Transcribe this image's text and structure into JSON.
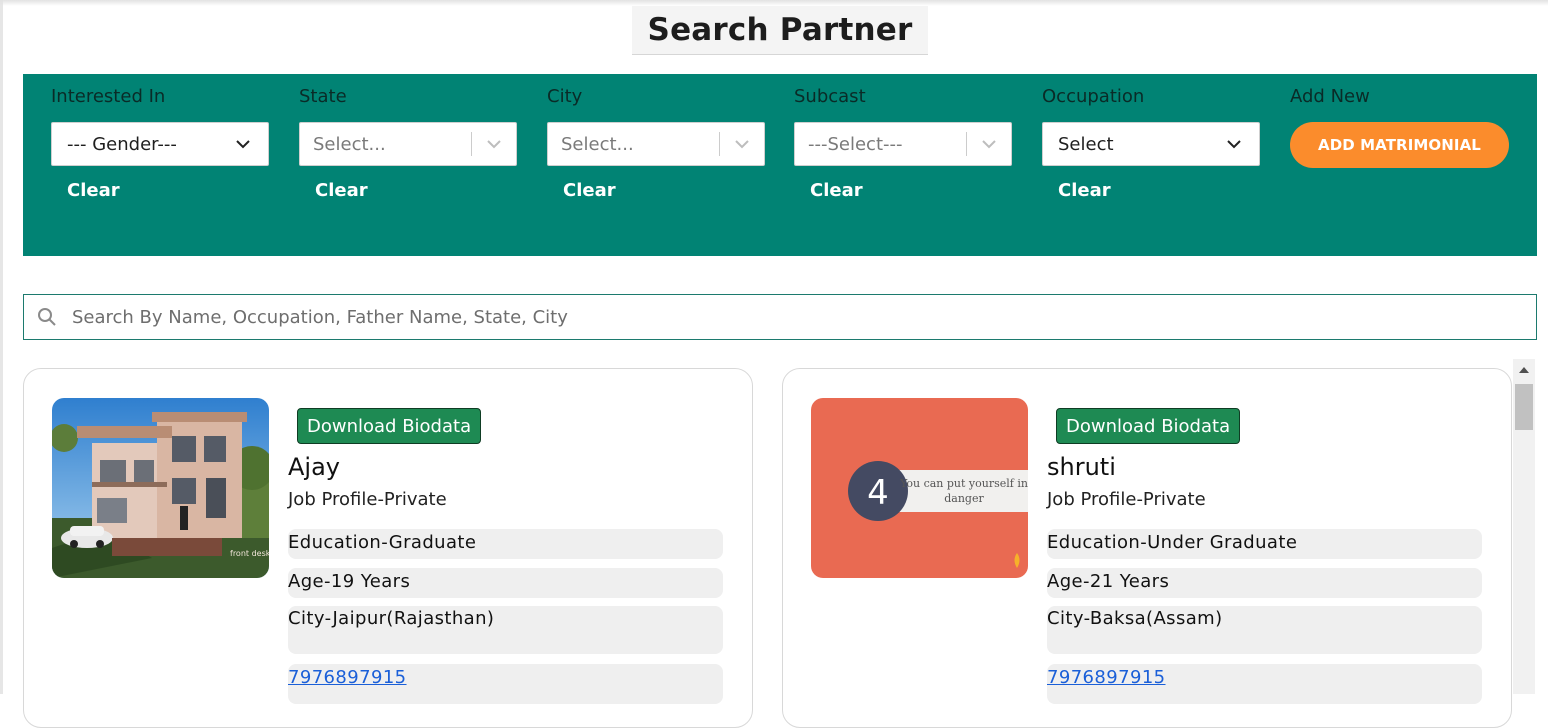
{
  "page": {
    "title": "Search Partner"
  },
  "filters": [
    {
      "label": "Interested In",
      "value": "--- Gender---",
      "kind": "native",
      "clear": "Clear"
    },
    {
      "label": "State",
      "value": "Select...",
      "kind": "placeholder",
      "clear": "Clear"
    },
    {
      "label": "City",
      "value": "Select...",
      "kind": "placeholder",
      "clear": "Clear"
    },
    {
      "label": "Subcast",
      "value": "---Select---",
      "kind": "placeholder",
      "clear": "Clear"
    },
    {
      "label": "Occupation",
      "value": "Select",
      "kind": "native",
      "clear": "Clear"
    }
  ],
  "add_new": {
    "label": "Add New",
    "button": "ADD MATRIMONIAL"
  },
  "search": {
    "placeholder": "Search By Name, Occupation, Father Name, State, City"
  },
  "cards": [
    {
      "download": "Download Biodata",
      "name": "Ajay",
      "job": "Job Profile-Private",
      "education": "Education-Graduate",
      "age": "Age-19 Years",
      "city": "City-Jaipur(Rajasthan)",
      "phone": "7976897915",
      "photo": {
        "kind": "house",
        "caption": "front desk"
      }
    },
    {
      "download": "Download Biodata",
      "name": "shruti",
      "job": "Job Profile-Private",
      "education": "Education-Under Graduate",
      "age": "Age-21 Years",
      "city": "City-Baksa(Assam)",
      "phone": "7976897915",
      "photo": {
        "kind": "slide",
        "number": "4",
        "text_line1": "You can put yourself in",
        "text_line2": "danger"
      }
    }
  ],
  "colors": {
    "filter_bar": "#018374",
    "add_button": "#fb8c2c",
    "download_button": "#1e8a53",
    "link": "#1a5fd8"
  },
  "icons": {
    "search": "search-icon",
    "dropdown": "chevron-down-icon",
    "scroll_up": "scroll-up-arrow-icon"
  }
}
